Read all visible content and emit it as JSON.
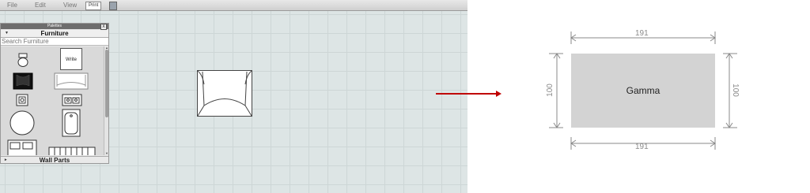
{
  "menu": {
    "file": "File",
    "edit": "Edit",
    "view": "View",
    "print": "Print"
  },
  "palette": {
    "title": "Palettes",
    "close": "X",
    "category": "Furniture",
    "search_placeholder": "Search Furniture",
    "write_here": "Write here",
    "footer": "Wall Parts"
  },
  "diagram": {
    "label": "Gamma",
    "width_top": "191",
    "width_bottom": "191",
    "height_left": "100",
    "height_right": "100",
    "arrow_color": "#c00000",
    "fill_color": "#d3d3d3"
  }
}
